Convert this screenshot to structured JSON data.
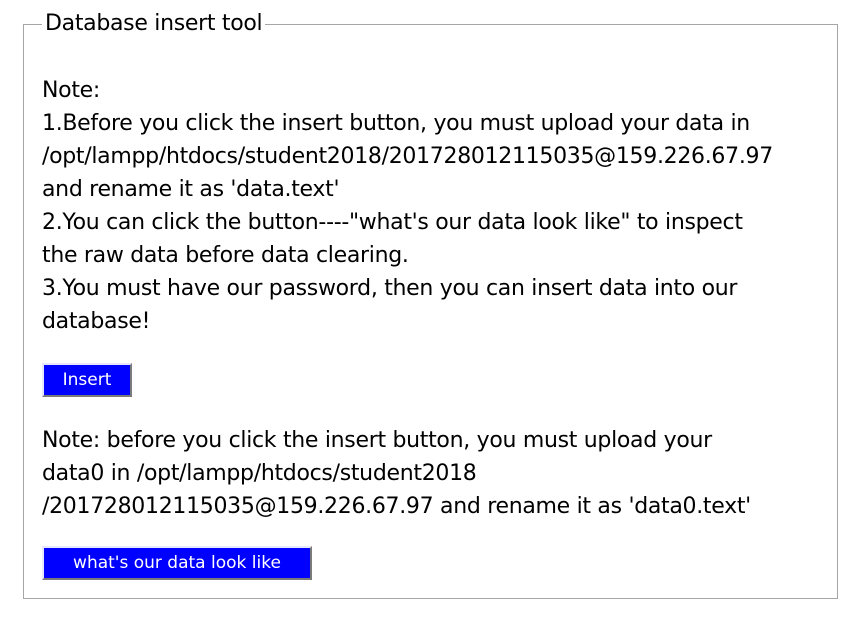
{
  "form": {
    "legend": "Database insert tool",
    "note1": {
      "lines": [
        "Note:",
        "1.Before you click the insert button, you must upload your data in",
        "/opt/lampp/htdocs/student2018/201728012115035@159.226.67.97",
        "and rename it as 'data.text'",
        "2.You can click the button----\"what's our data look like\" to inspect",
        "the raw data before data clearing.",
        "3.You must have our password, then you can insert data into our",
        "database!"
      ]
    },
    "insert_button_label": "Insert",
    "note2": {
      "lines": [
        "Note: before you click the insert button, you must upload your",
        "data0 in /opt/lampp/htdocs/student2018",
        "/201728012115035@159.226.67.97 and rename it as 'data0.text'"
      ]
    },
    "data_button_label": "what's our data look like"
  },
  "colors": {
    "button_background": "#0000ff",
    "button_text": "#ffffff",
    "border": "#a6a6a6"
  }
}
